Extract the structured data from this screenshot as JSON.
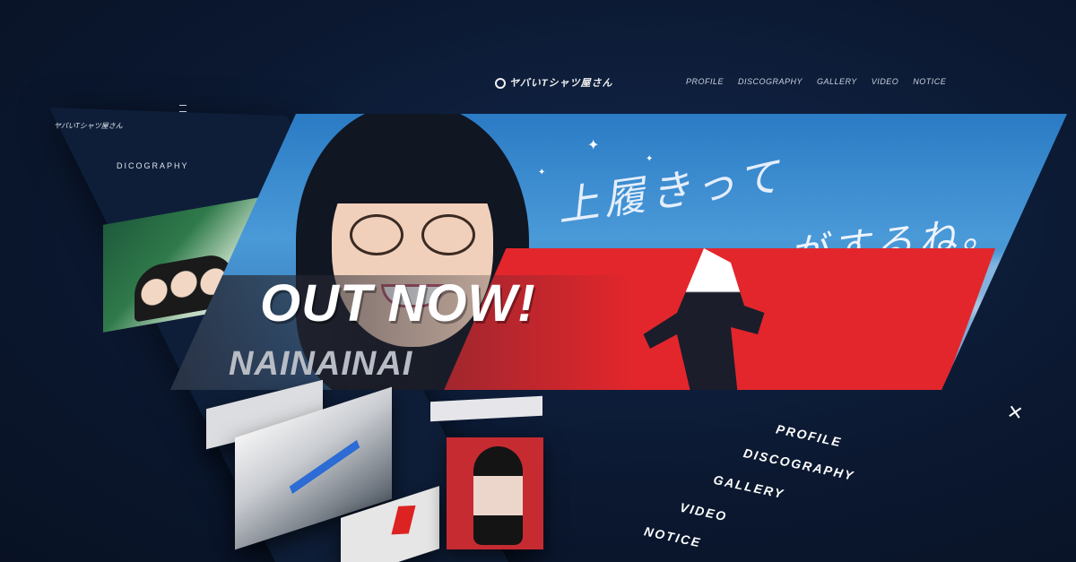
{
  "brand": {
    "logo_text": "ヤバいTシャツ屋さん"
  },
  "top_nav": {
    "items": [
      "PROFILE",
      "DISCOGRAPHY",
      "GALLERY",
      "VIDEO",
      "NOTICE"
    ]
  },
  "left_panel": {
    "logo_text": "ヤバいTシャツ屋さん",
    "section_title": "DICOGRAPHY"
  },
  "hero": {
    "headline": "OUT NOW!",
    "subtitle": "NAINAINAI",
    "sky_text_line1": "上履きって",
    "sky_text_line2": "がするね。"
  },
  "side_menu": {
    "close_label": "×",
    "items": [
      "PROFILE",
      "DISCOGRAPHY",
      "GALLERY",
      "VIDEO",
      "NOTICE"
    ]
  }
}
